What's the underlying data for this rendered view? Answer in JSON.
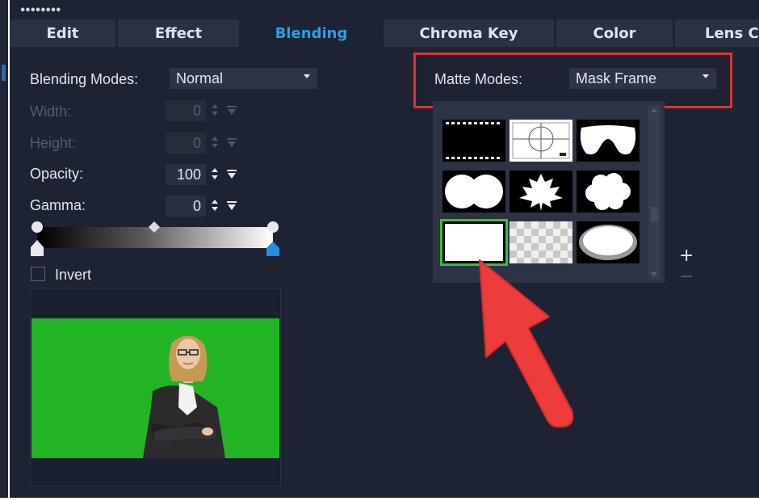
{
  "tabs": [
    {
      "label": "Edit",
      "active": false
    },
    {
      "label": "Effect",
      "active": false
    },
    {
      "label": "Blending",
      "active": true
    },
    {
      "label": "Chroma Key",
      "active": false
    },
    {
      "label": "Color",
      "active": false
    },
    {
      "label": "Lens C",
      "active": false
    }
  ],
  "blending": {
    "modes_label": "Blending Modes:",
    "mode_value": "Normal",
    "width_label": "Width:",
    "width_value": "0",
    "height_label": "Height:",
    "height_value": "0",
    "opacity_label": "Opacity:",
    "opacity_value": "100",
    "gamma_label": "Gamma:",
    "gamma_value": "0",
    "invert_label": "Invert",
    "invert_checked": false
  },
  "matte": {
    "modes_label": "Matte Modes:",
    "mode_value": "Mask Frame",
    "thumbnails": [
      "film-strip",
      "crosshair-target",
      "goggles",
      "double-circle",
      "maple-leaf",
      "cloud",
      "rectangle",
      "checkerboard",
      "oval-frame"
    ],
    "selected_thumbnail": "rectangle",
    "add_label": "+",
    "remove_label": "−"
  },
  "colors": {
    "active_tab": "#2d9fe8",
    "highlight_box": "#e0312f",
    "selection": "#3fbe44",
    "arrow": "#ec3c3c",
    "green_screen": "#22b424"
  }
}
